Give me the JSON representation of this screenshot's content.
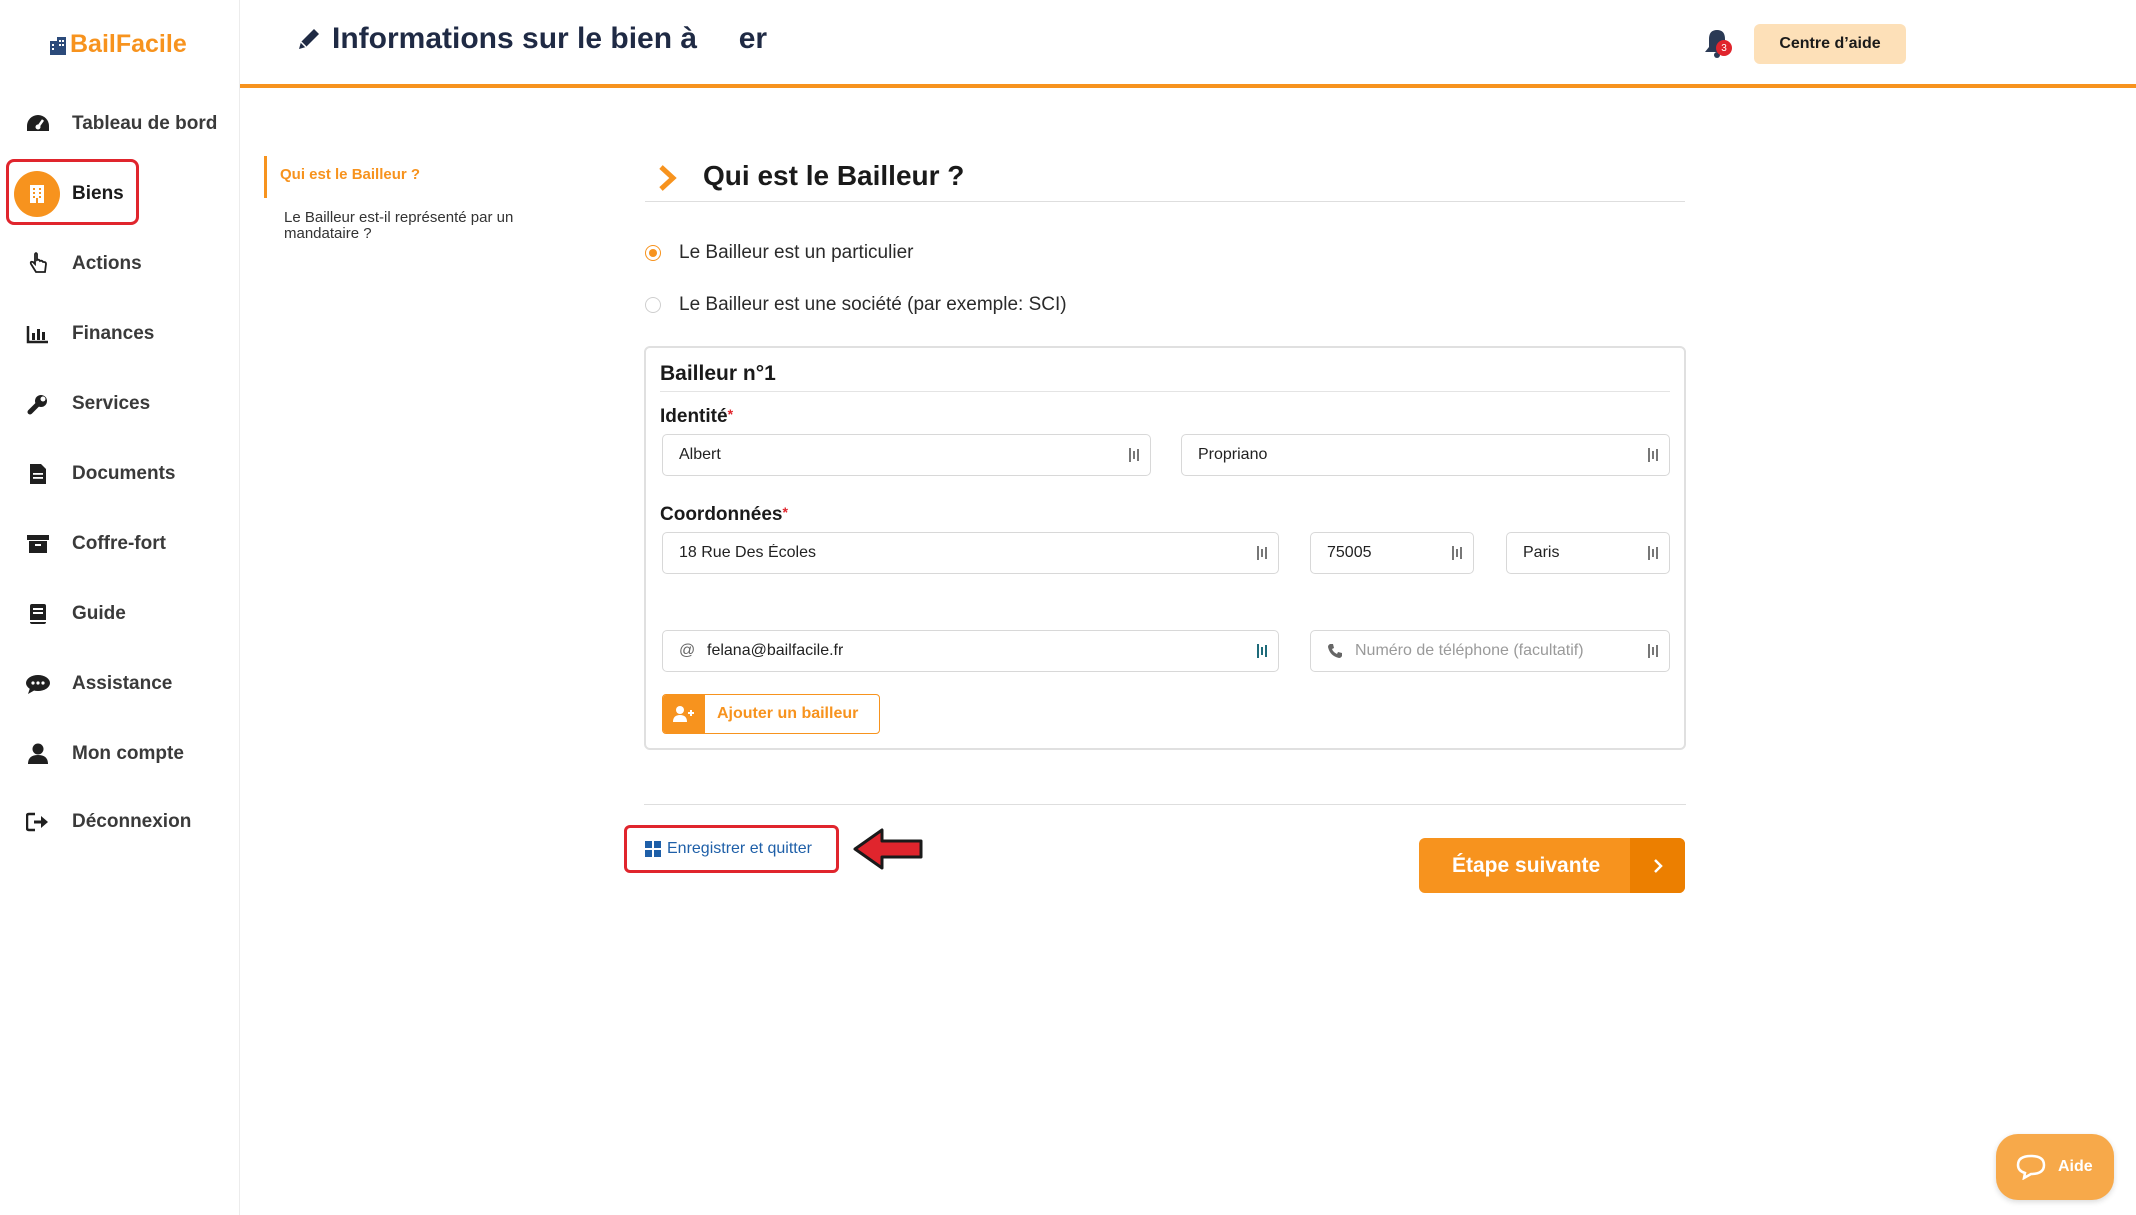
{
  "app": {
    "logo_text": "BailFacile"
  },
  "sidebar": {
    "items": [
      {
        "label": "Tableau de bord",
        "icon": "dashboard-icon"
      },
      {
        "label": "Biens",
        "icon": "building-icon",
        "active": true
      },
      {
        "label": "Actions",
        "icon": "hand-pointer-icon"
      },
      {
        "label": "Finances",
        "icon": "bar-chart-icon"
      },
      {
        "label": "Services",
        "icon": "wrench-icon"
      },
      {
        "label": "Documents",
        "icon": "document-icon"
      },
      {
        "label": "Coffre-fort",
        "icon": "archive-box-icon"
      },
      {
        "label": "Guide",
        "icon": "book-icon"
      },
      {
        "label": "Assistance",
        "icon": "chat-icon"
      },
      {
        "label": "Mon compte",
        "icon": "user-icon"
      },
      {
        "label": "Déconnexion",
        "icon": "logout-icon"
      }
    ]
  },
  "header": {
    "title": "Informations sur le bien à     er",
    "help_center": "Centre d’aide",
    "notification_count": "3"
  },
  "steps": {
    "active": "Qui est le Bailleur ?",
    "next": "Le Bailleur est-il représenté par un mandataire ?"
  },
  "section": {
    "title": "Qui est le Bailleur ?",
    "options": [
      {
        "label": "Le Bailleur est un particulier",
        "checked": true
      },
      {
        "label": "Le Bailleur est une société (par exemple: SCI)",
        "checked": false
      }
    ]
  },
  "card": {
    "title": "Bailleur n°1",
    "identity_label": "Identité",
    "required_mark": "*",
    "first_name": "Albert",
    "last_name": "Propriano",
    "coords_label": "Coordonnées",
    "address": "18 Rue Des Écoles",
    "postal_code": "75005",
    "city": "Paris",
    "email_prefix": "@",
    "email": "felana@bailfacile.fr",
    "phone_placeholder": "Numéro de téléphone (facultatif)",
    "add_button": "Ajouter un bailleur"
  },
  "footer": {
    "save_quit": "Enregistrer et quitter",
    "next_step": "Étape suivante"
  },
  "widget": {
    "aide": "Aide"
  },
  "colors": {
    "accent": "#f7931e",
    "highlight": "#e0252d",
    "link": "#1e5fa8"
  }
}
